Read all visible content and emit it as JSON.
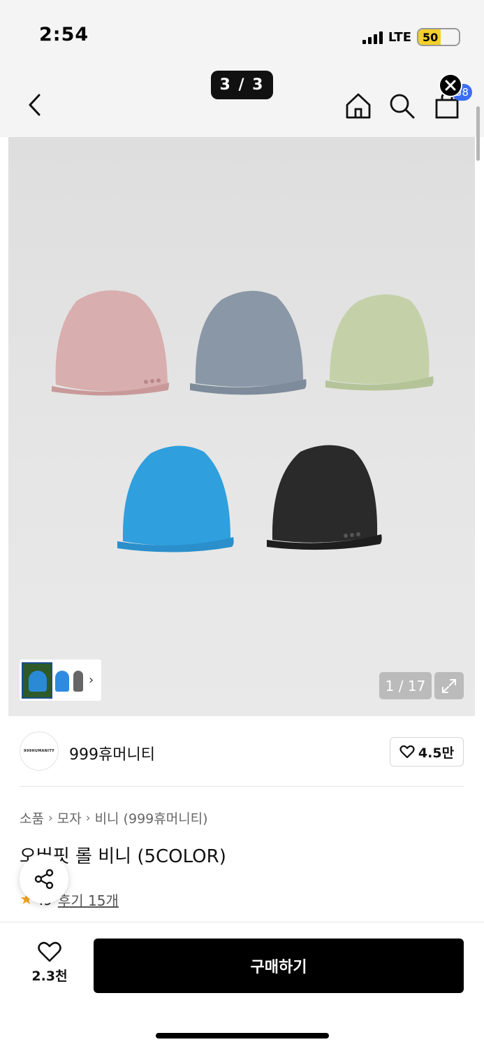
{
  "status_bar": {
    "time": "2:54",
    "network": "LTE",
    "battery": "50"
  },
  "header": {
    "back_icon": "chevron-left-icon",
    "page_indicator": "3 / 3",
    "home_icon": "home-icon",
    "search_icon": "search-icon",
    "cart_icon": "shopping-bag-icon",
    "cart_badge": "58",
    "close_icon": "close-icon"
  },
  "gallery": {
    "image_alt_colors": [
      "#d8a8a8",
      "#8997a6",
      "#c2cfa4",
      "#2f9fde",
      "#2a2a2a"
    ],
    "counter": "1 / 17",
    "expand_icon": "expand-icon",
    "thumbnail_arrow": "chevron-right-icon"
  },
  "brand": {
    "logo_text": "999HUMANITY",
    "name": "999휴머니티",
    "like_count": "4.5만"
  },
  "breadcrumb": [
    "소품",
    "모자",
    "비니 (999휴머니티)"
  ],
  "product": {
    "title": "오버핏 롤 비니 (5COLOR)",
    "rating": ".9",
    "review_link": "후기 15개"
  },
  "bottom": {
    "wish_count": "2.3천",
    "buy_label": "구매하기"
  }
}
